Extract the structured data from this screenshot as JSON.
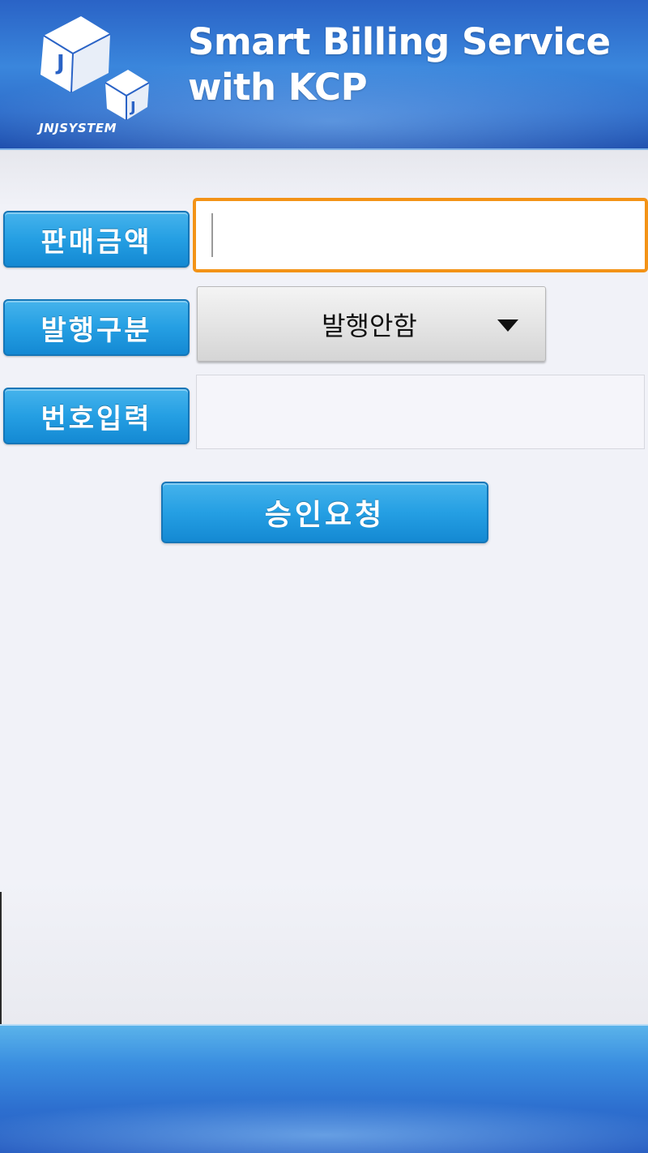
{
  "header": {
    "logo_text": "JNJSYSTEM",
    "logo_letter": "J",
    "title_line1": "Smart Billing Service",
    "title_line2": "with KCP"
  },
  "form": {
    "amount_label": "판매금액",
    "amount_value": "",
    "issue_type_label": "발행구분",
    "issue_type_selected": "발행안함",
    "number_label": "번호입력",
    "number_value": "",
    "submit_label": "승인요청"
  },
  "colors": {
    "accent_blue": "#259fe3",
    "focus_orange": "#f39317",
    "header_blue": "#2a63c6"
  },
  "icons": {
    "dropdown_arrow": "triangle-down-icon",
    "logo": "cube-logo-icon"
  }
}
